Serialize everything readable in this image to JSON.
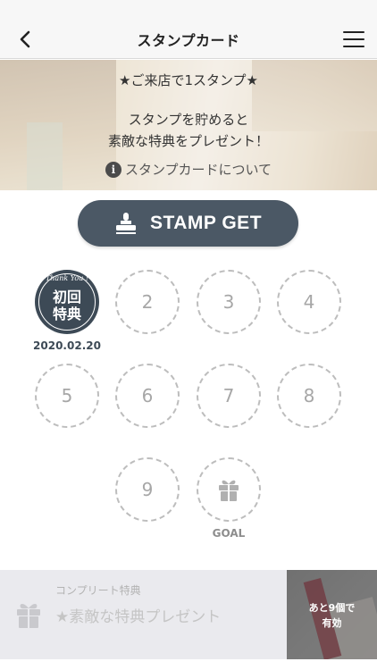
{
  "nav": {
    "title": "スタンプカード",
    "back_icon": "chevron-left-icon",
    "menu_icon": "hamburger-menu-icon"
  },
  "hero": {
    "headline": "★ご来店で1スタンプ★",
    "line1": "スタンプを貯めると",
    "line2": "素敵な特典をプレゼント！",
    "about_icon": "info-icon",
    "about_label": "スタンプカードについて"
  },
  "stamp_button": {
    "label": "STAMP GET",
    "icon": "stamp-icon",
    "color": "#4b5865"
  },
  "stamps": {
    "first": {
      "arc_text": "Thank You !",
      "label_line1": "初回",
      "label_line2": "特典",
      "date": "2020.02.20",
      "color": "#3d4a56"
    },
    "slots": [
      "2",
      "3",
      "4",
      "5",
      "6",
      "7",
      "8",
      "9"
    ],
    "goal_icon": "gift-icon",
    "goal_label": "GOAL"
  },
  "complete": {
    "small_label": "コンプリート特典",
    "reward": "★素敵な特典プレゼント",
    "gift_icon": "gift-icon",
    "remaining_line1": "あと9個で",
    "remaining_line2": "有効"
  }
}
